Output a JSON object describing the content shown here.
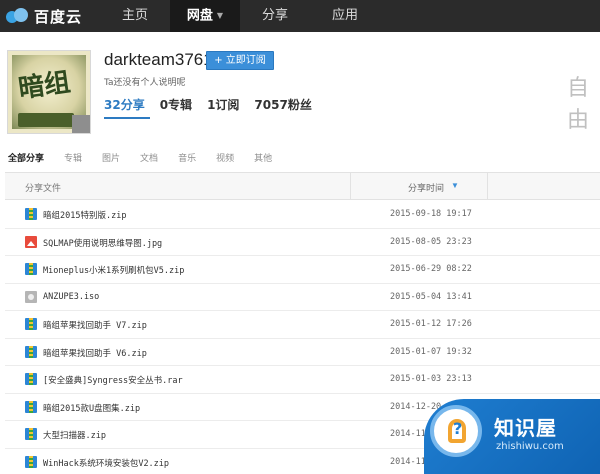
{
  "nav": {
    "logo_text": "百度云",
    "items": [
      {
        "label": "主页"
      },
      {
        "label": "网盘"
      },
      {
        "label": "分享"
      },
      {
        "label": "应用"
      }
    ],
    "caret_icon": "chevron-down-icon"
  },
  "profile": {
    "username": "darkteam3761",
    "subscribe_label": "+ 立即订阅",
    "bio": "Ta还没有个人说明呢",
    "stats": [
      {
        "label": "32分享"
      },
      {
        "label": "0专辑"
      },
      {
        "label": "1订阅"
      },
      {
        "label": "7057粉丝"
      }
    ],
    "avatar_glyph": "暗组",
    "side_text": "自由"
  },
  "filters": [
    {
      "label": "全部分享"
    },
    {
      "label": "专辑"
    },
    {
      "label": "图片"
    },
    {
      "label": "文档"
    },
    {
      "label": "音乐"
    },
    {
      "label": "视频"
    },
    {
      "label": "其他"
    }
  ],
  "table": {
    "col_file": "分享文件",
    "col_time": "分享时间",
    "sort_icon": "arrow-down-icon",
    "rows": [
      {
        "type": "zip",
        "name": "暗组2015特别版.zip",
        "time": "2015-09-18 19:17"
      },
      {
        "type": "jpg",
        "name": "SQLMAP使用说明思维导图.jpg",
        "time": "2015-08-05 23:23"
      },
      {
        "type": "zip",
        "name": "Mioneplus小米1系列刷机包V5.zip",
        "time": "2015-06-29 08:22"
      },
      {
        "type": "iso",
        "name": "ANZUPE3.iso",
        "time": "2015-05-04 13:41"
      },
      {
        "type": "zip",
        "name": "暗组苹果找回助手 V7.zip",
        "time": "2015-01-12 17:26"
      },
      {
        "type": "zip",
        "name": "暗组苹果找回助手 V6.zip",
        "time": "2015-01-07 19:32"
      },
      {
        "type": "zip",
        "name": "[安全盛典]Syngress安全丛书.rar",
        "time": "2015-01-03 23:13"
      },
      {
        "type": "zip",
        "name": "暗组2015款U盘图集.zip",
        "time": "2014-12-20"
      },
      {
        "type": "zip",
        "name": "大型扫描器.zip",
        "time": "2014-11-"
      },
      {
        "type": "zip",
        "name": "WinHack系统环境安装包V2.zip",
        "time": "2014-11-24"
      }
    ]
  },
  "watermark": {
    "title": "知识屋",
    "url": "zhishiwu.com"
  }
}
